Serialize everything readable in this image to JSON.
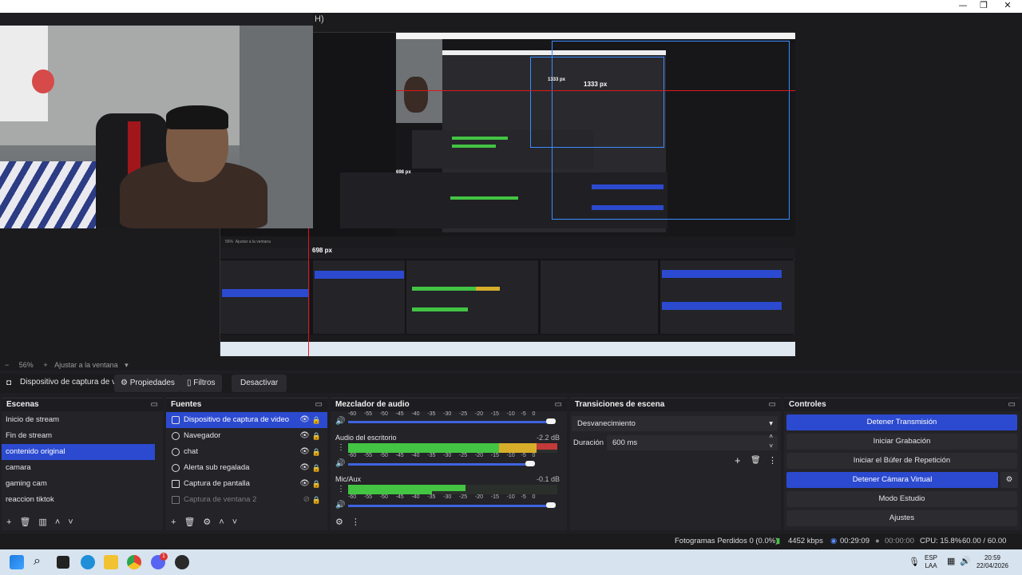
{
  "window": {
    "menu_fragment": "H)",
    "controls": [
      "—",
      "❐",
      "✕"
    ]
  },
  "preview": {
    "inner_zoom_text": "56%",
    "inner_fit_text": "Ajustar a la ventana",
    "measure_698": "698 px",
    "measure_1333": "1333 px",
    "measure_1333_small": "1333 px",
    "measure_698_small": "698 px"
  },
  "zoombar": {
    "zoom": "56%",
    "fit": "Ajustar a la ventana"
  },
  "source_toolbar": {
    "source_name": "Dispositivo de captura de v",
    "properties": "Propiedades",
    "filters": "Filtros",
    "deactivate": "Desactivar"
  },
  "scenes": {
    "title": "Escenas",
    "items": [
      {
        "label": "Inicio de stream"
      },
      {
        "label": "Fin de stream"
      },
      {
        "label": "contenido original"
      },
      {
        "label": "camara"
      },
      {
        "label": "gaming cam"
      },
      {
        "label": "reaccion tiktok"
      }
    ],
    "selected_index": 2
  },
  "sources": {
    "title": "Fuentes",
    "items": [
      {
        "label": "Dispositivo de captura de video",
        "icon": "camera-icon"
      },
      {
        "label": "Navegador",
        "icon": "globe-icon"
      },
      {
        "label": "chat",
        "icon": "globe-icon"
      },
      {
        "label": "Alerta sub regalada",
        "icon": "globe-icon"
      },
      {
        "label": "Captura de pantalla",
        "icon": "monitor-icon"
      },
      {
        "label": "Captura de ventana 2",
        "icon": "window-icon"
      }
    ]
  },
  "mixer": {
    "title": "Mezclador de audio",
    "scale": [
      "-60",
      "-55",
      "-50",
      "-45",
      "-40",
      "-35",
      "-30",
      "-25",
      "-20",
      "-15",
      "-10",
      "-5",
      "0"
    ],
    "channels": [
      {
        "name": "",
        "db": ""
      },
      {
        "name": "Audio del escritorio",
        "db": "-2.2 dB"
      },
      {
        "name": "Mic/Aux",
        "db": "-0.1 dB"
      }
    ]
  },
  "transitions": {
    "title": "Transiciones de escena",
    "selected": "Desvanecimiento",
    "duration_label": "Duración",
    "duration_value": "600 ms"
  },
  "controls": {
    "title": "Controles",
    "stop_stream": "Detener Transmisión",
    "start_recording": "Iniciar Grabación",
    "start_replay": "Iniciar el Búfer de Repetición",
    "stop_virtual_cam": "Detener Cámara Virtual",
    "studio_mode": "Modo Estudio",
    "settings": "Ajustes"
  },
  "status": {
    "dropped": "Fotogramas Perdidos 0 (0.0%)",
    "bitrate": "4452 kbps",
    "stream_time": "00:29:09",
    "rec_time": "00:00:00",
    "cpu": "CPU: 15.8%",
    "fps": "60.00 / 60.00 FPS"
  },
  "taskbar": {
    "lang": "ESP",
    "layout": "LAA",
    "time": "20:59",
    "date": "22/04/2026",
    "badge": "1"
  }
}
